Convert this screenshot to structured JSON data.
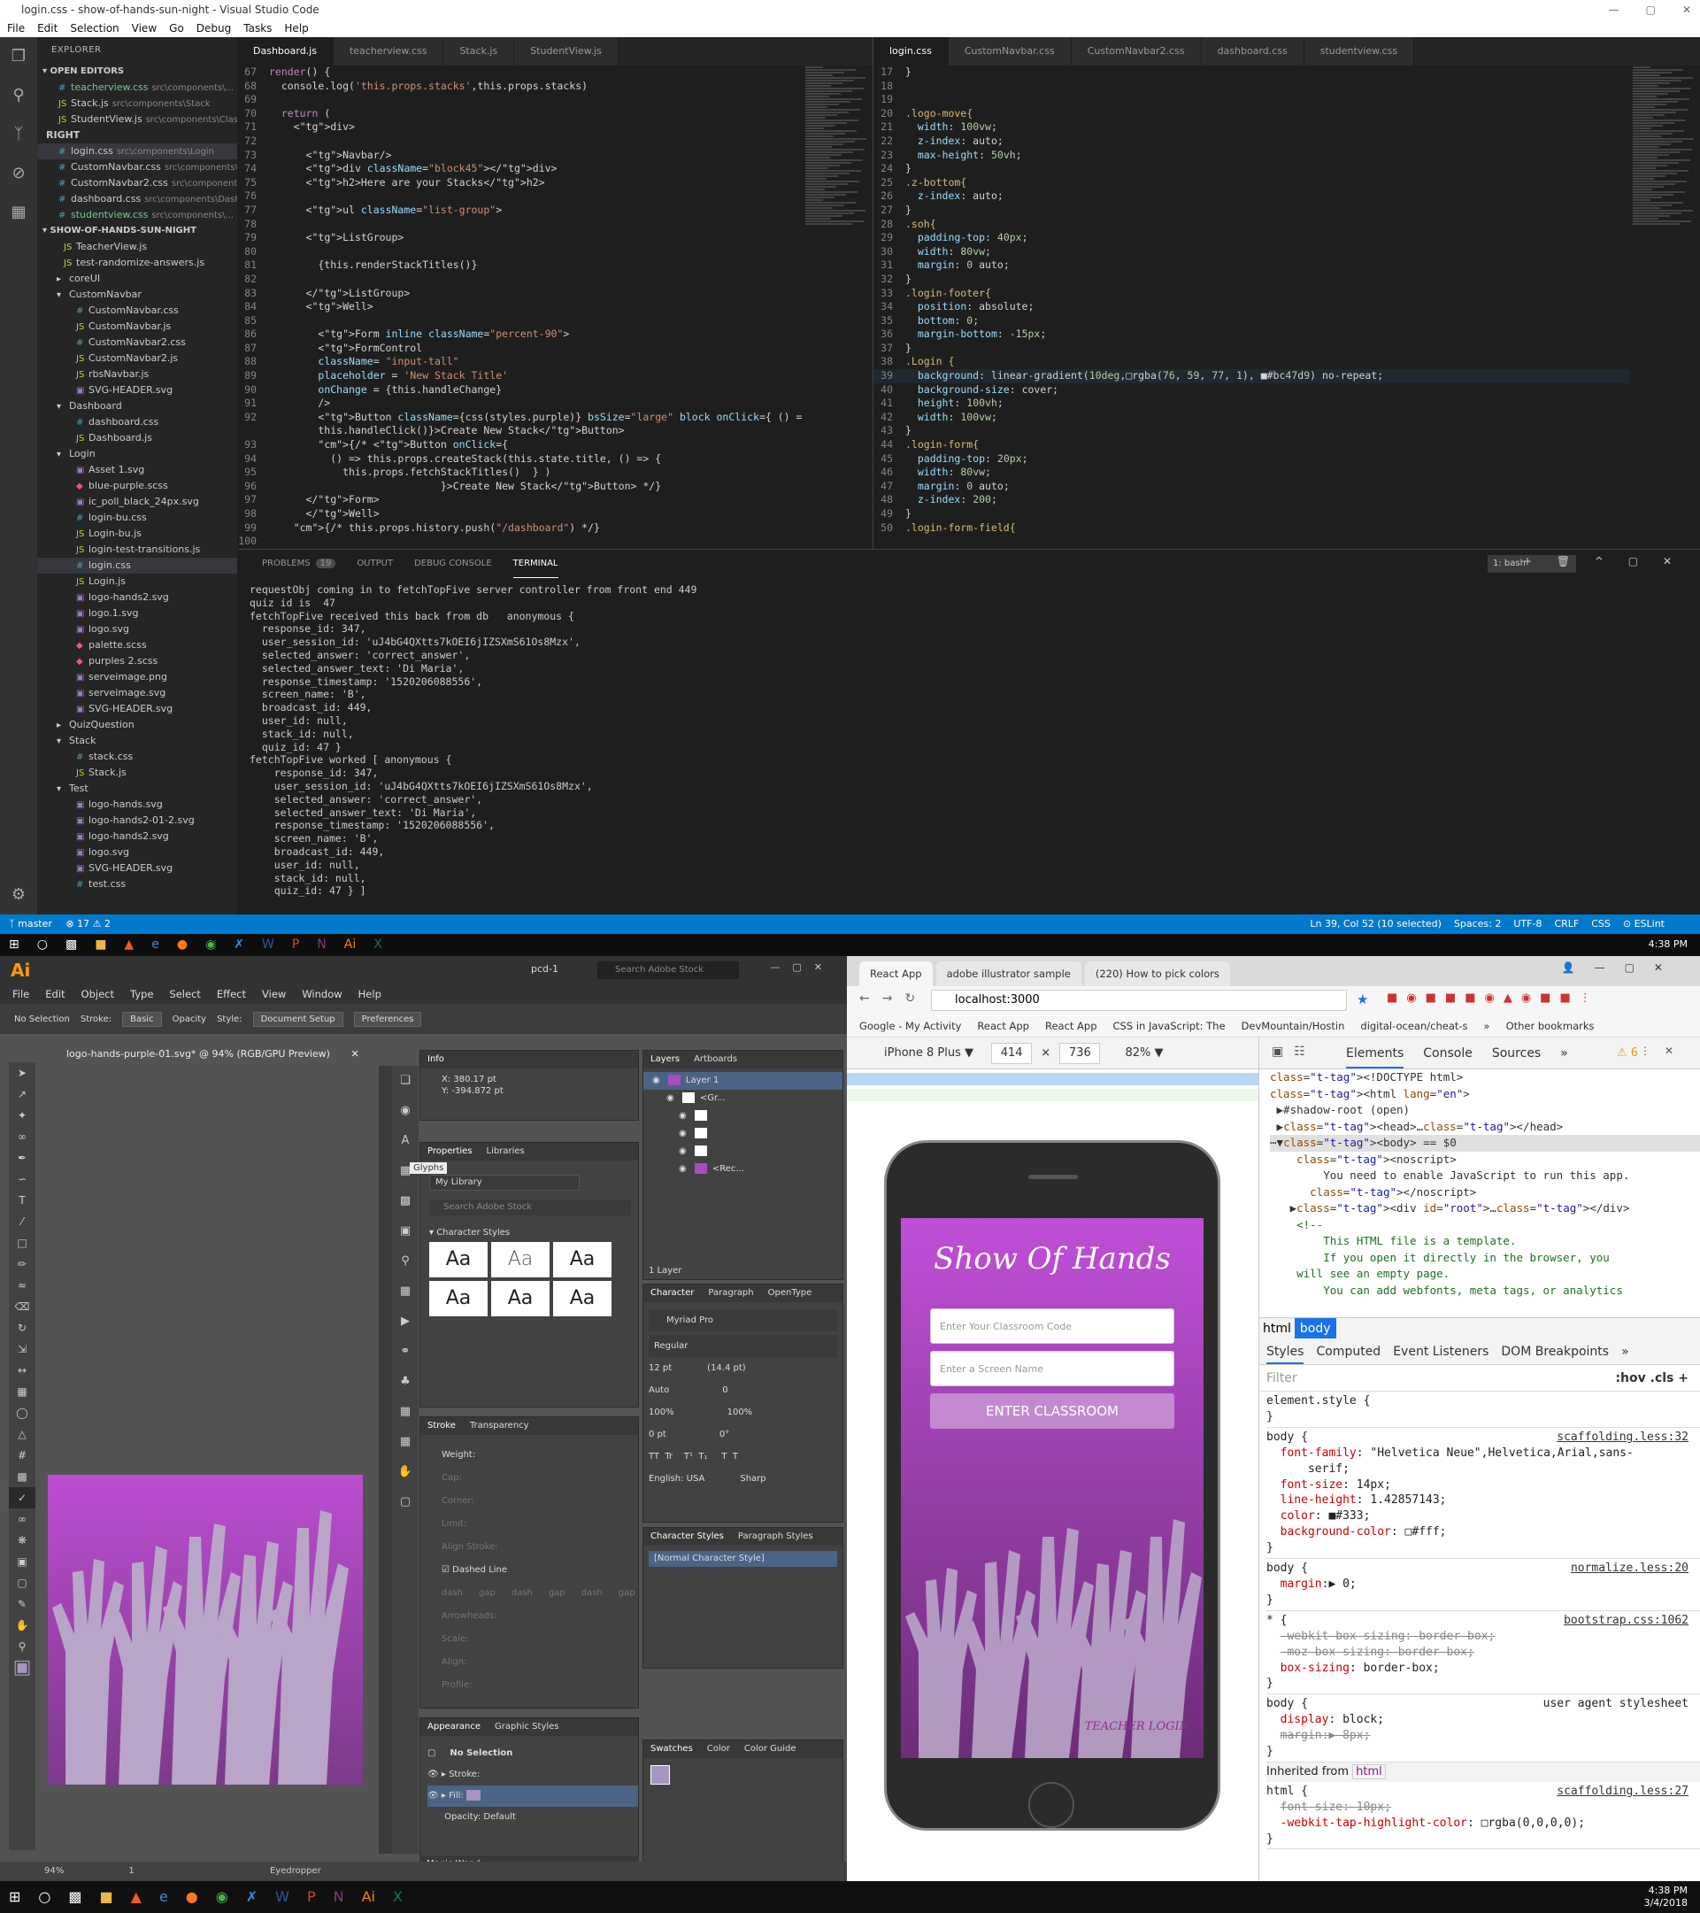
{
  "vscode": {
    "title": "login.css - show-of-hands-sun-night - Visual Studio Code",
    "menu": [
      "File",
      "Edit",
      "Selection",
      "View",
      "Go",
      "Debug",
      "Tasks",
      "Help"
    ],
    "explorer": "EXPLORER",
    "open_editors": "OPEN EDITORS",
    "open_items": [
      {
        "name": "teacherview.css",
        "path": "src\\components\\...",
        "mod": "1"
      },
      {
        "name": "Stack.js",
        "path": "src\\components\\Stack"
      },
      {
        "name": "StudentView.js",
        "path": "src\\components\\Classr..."
      },
      {
        "name": "RIGHT",
        "path": ""
      },
      {
        "name": "login.css",
        "path": "src\\components\\Login"
      },
      {
        "name": "CustomNavbar.css",
        "path": "src\\components\\C..."
      },
      {
        "name": "CustomNavbar2.css",
        "path": "src\\components\\C..."
      },
      {
        "name": "dashboard.css",
        "path": "src\\components\\Dashb..."
      },
      {
        "name": "studentview.css",
        "path": "src\\components\\...",
        "mod": "1"
      }
    ],
    "project": "SHOW-OF-HANDS-SUN-NIGHT",
    "files": [
      "TeacherView.js",
      "test-randomize-answers.js",
      "coreUI",
      "CustomNavbar",
      "CustomNavbar.css",
      "CustomNavbar.js",
      "CustomNavbar2.css",
      "CustomNavbar2.js",
      "rbsNavbar.js",
      "SVG-HEADER.svg",
      "Dashboard",
      "dashboard.css",
      "Dashboard.js",
      "Login",
      "Asset 1.svg",
      "blue-purple.scss",
      "ic_poll_black_24px.svg",
      "login-bu.css",
      "Login-bu.js",
      "login-test-transitions.js",
      "login.css",
      "Login.js",
      "logo-hands2.svg",
      "logo.1.svg",
      "logo.svg",
      "palette.scss",
      "purples 2.scss",
      "serveimage.png",
      "serveimage.svg",
      "SVG-HEADER.svg",
      "QuizQuestion",
      "Stack",
      "stack.css",
      "Stack.js",
      "Test",
      "logo-hands.svg",
      "logo-hands2-01-2.svg",
      "logo-hands2.svg",
      "logo.svg",
      "SVG-HEADER.svg",
      "test.css"
    ],
    "left_tabs": [
      "Dashboard.js",
      "teacherview.css",
      "Stack.js",
      "StudentView.js"
    ],
    "right_tabs": [
      "login.css",
      "CustomNavbar.css",
      "CustomNavbar2.css",
      "dashboard.css",
      "studentview.css"
    ],
    "left_code": [
      [
        "67",
        "render() {"
      ],
      [
        "68",
        "  console.log('this.props.stacks',this.props.stacks)"
      ],
      [
        "69",
        ""
      ],
      [
        "70",
        "  return ("
      ],
      [
        "71",
        "    <div>"
      ],
      [
        "72",
        ""
      ],
      [
        "73",
        "      <Navbar/>"
      ],
      [
        "74",
        "      <div className=\"block45\"></div>"
      ],
      [
        "75",
        "      <h2>Here are your Stacks</h2>"
      ],
      [
        "76",
        ""
      ],
      [
        "77",
        "      <ul className=\"list-group\">"
      ],
      [
        "78",
        ""
      ],
      [
        "79",
        "      <ListGroup>"
      ],
      [
        "80",
        ""
      ],
      [
        "81",
        "        {this.renderStackTitles()}"
      ],
      [
        "82",
        ""
      ],
      [
        "83",
        "      </ListGroup>"
      ],
      [
        "84",
        "      <Well>"
      ],
      [
        "85",
        ""
      ],
      [
        "86",
        "        <Form inline className=\"percent-90\">"
      ],
      [
        "87",
        "        <FormControl"
      ],
      [
        "88",
        "        className= \"input-tall\""
      ],
      [
        "89",
        "        placeholder = 'New Stack Title'"
      ],
      [
        "90",
        "        onChange = {this.handleChange}"
      ],
      [
        "91",
        "        />"
      ],
      [
        "92",
        "        <Button className={css(styles.purple)} bsSize=\"large\" block onClick={ () =>"
      ],
      [
        "",
        "        this.handleClick()}>Create New Stack</Button>"
      ],
      [
        "93",
        "        {/* <Button onClick={"
      ],
      [
        "94",
        "          () => this.props.createStack(this.state.title, () => {"
      ],
      [
        "95",
        "            this.props.fetchStackTitles()  } )"
      ],
      [
        "96",
        "                            }>Create New Stack</Button> */}"
      ],
      [
        "97",
        "      </Form>"
      ],
      [
        "98",
        "      </Well>"
      ],
      [
        "99",
        "    {/* this.props.history.push(\"/dashboard\") */}"
      ],
      [
        "100",
        ""
      ]
    ],
    "right_code": [
      [
        "17",
        "}"
      ],
      [
        "18",
        ""
      ],
      [
        "19",
        ""
      ],
      [
        "20",
        ".logo-move{"
      ],
      [
        "21",
        "  width: 100vw;"
      ],
      [
        "22",
        "  z-index: auto;"
      ],
      [
        "23",
        "  max-height: 50vh;"
      ],
      [
        "24",
        "}"
      ],
      [
        "25",
        ".z-bottom{"
      ],
      [
        "26",
        "  z-index: auto;"
      ],
      [
        "27",
        "}"
      ],
      [
        "28",
        ".soh{"
      ],
      [
        "29",
        "  padding-top: 40px;"
      ],
      [
        "30",
        "  width: 80vw;"
      ],
      [
        "31",
        "  margin: 0 auto;"
      ],
      [
        "32",
        "}"
      ],
      [
        "33",
        ".login-footer{"
      ],
      [
        "34",
        "  position: absolute;"
      ],
      [
        "35",
        "  bottom: 0;"
      ],
      [
        "36",
        "  margin-bottom: -15px;"
      ],
      [
        "37",
        "}"
      ],
      [
        "38",
        ".Login {"
      ],
      [
        "39",
        "  background: linear-gradient(10deg,□rgba(76, 59, 77, 1), ■#bc47d9) no-repeat;"
      ],
      [
        "40",
        "  background-size: cover;"
      ],
      [
        "41",
        "  height: 100vh;"
      ],
      [
        "42",
        "  width: 100vw;"
      ],
      [
        "43",
        "}"
      ],
      [
        "44",
        ".login-form{"
      ],
      [
        "45",
        "  padding-top: 20px;"
      ],
      [
        "46",
        "  width: 80vw;"
      ],
      [
        "47",
        "  margin: 0 auto;"
      ],
      [
        "48",
        "  z-index: 200;"
      ],
      [
        "49",
        "}"
      ],
      [
        "50",
        ".login-form-field{"
      ]
    ],
    "panel_tabs": [
      "PROBLEMS",
      "OUTPUT",
      "DEBUG CONSOLE",
      "TERMINAL"
    ],
    "problems_count": "19",
    "terminal_select": "1: bash",
    "terminal": [
      "requestObj coming in to fetchTopFive server controller from front end 449",
      "quiz id is  47",
      "fetchTopFive received this back from db   anonymous {",
      "  response_id: 347,",
      "  user_session_id: 'uJ4bG4QXtts7kOEI6jIZSXmS61Os8Mzx',",
      "  selected_answer: 'correct_answer',",
      "  selected_answer_text: 'Di Maria',",
      "  response_timestamp: '1520206088556',",
      "  screen_name: 'B',",
      "  broadcast_id: 449,",
      "  user_id: null,",
      "  stack_id: null,",
      "  quiz_id: 47 }",
      "fetchTopFive worked [ anonymous {",
      "    response_id: 347,",
      "    user_session_id: 'uJ4bG4QXtts7kOEI6jIZSXmS61Os8Mzx',",
      "    selected_answer: 'correct_answer',",
      "    selected_answer_text: 'Di Maria',",
      "    response_timestamp: '1520206088556',",
      "    screen_name: 'B',",
      "    broadcast_id: 449,",
      "    user_id: null,",
      "    stack_id: null,",
      "    quiz_id: 47 } ]"
    ],
    "status_left": "master",
    "status_errors": "⊗ 17 ⚠ 2",
    "status_right": [
      "Ln 39, Col 52 (10 selected)",
      "Spaces: 2",
      "UTF-8",
      "CRLF",
      "CSS",
      "⊙ ESLint"
    ]
  },
  "taskbar": {
    "time": "4:38 PM",
    "time2": "4:38 PM",
    "date": "3/4/2018"
  },
  "illustrator": {
    "logo": "Ai",
    "workspace": "pcd-1",
    "search": "Search Adobe Stock",
    "menu": [
      "File",
      "Edit",
      "Object",
      "Type",
      "Select",
      "Effect",
      "View",
      "Window",
      "Help"
    ],
    "ctrl": [
      "No Selection",
      "Stroke:",
      "Basic",
      "Opacity",
      "Style:",
      "Document Setup",
      "Preferences"
    ],
    "doc_tab": "logo-hands-purple-01.svg* @ 94% (RGB/GPU Preview)",
    "info_title": "Info",
    "x": "X: 380.17 pt",
    "y": "Y: -394.872 pt",
    "prop_tabs": [
      "Properties",
      "Libraries"
    ],
    "glyphs": "Glyphs",
    "library": "My Library",
    "lib_search": "Search Adobe Stock",
    "char_styles": "Character Styles",
    "aa": "Aa",
    "stroke_tabs": [
      "Stroke",
      "Transparency"
    ],
    "weight": "Weight:",
    "stroke_labels": [
      "Cap:",
      "Corner:",
      "Limit:",
      "Align Stroke:"
    ],
    "dashed": "Dashed Line",
    "dash_labels": [
      "dash",
      "gap",
      "dash",
      "gap",
      "dash",
      "gap"
    ],
    "arrowheads": "Arrowheads:",
    "scale": "Scale:",
    "align": "Align:",
    "profile": "Profile:",
    "appearance_tabs": [
      "Appearance",
      "Graphic Styles"
    ],
    "no_selection": "No Selection",
    "stroke_lbl": "Stroke:",
    "fill_lbl": "Fill:",
    "opacity_lbl": "Opacity:",
    "opacity_val": "Default",
    "layers_tabs": [
      "Layers",
      "Artboards"
    ],
    "layers": [
      "Layer 1",
      "<Gr...",
      "",
      "",
      "",
      "<Rec..."
    ],
    "layer_count": "1 Layer",
    "character_tabs": [
      "Character",
      "Paragraph",
      "OpenType"
    ],
    "font": "Myriad Pro",
    "font_style": "Regular",
    "size": "12 pt",
    "leading": "(14.4 pt)",
    "kern": "Auto",
    "track": "0",
    "vscale": "100%",
    "hscale": "100%",
    "baseline": "0 pt",
    "rotate": "0°",
    "lang": "English: USA",
    "aa_mode": "Sharp",
    "cs_tabs": [
      "Character Styles",
      "Paragraph Styles"
    ],
    "normal_cs": "[Normal Character Style]",
    "swatch_tabs": [
      "Swatches",
      "Color",
      "Color Guide"
    ],
    "magic": "Magic Wand",
    "zoom": "94%",
    "page": "1",
    "tool": "Eyedropper"
  },
  "chrome": {
    "tabs": [
      "React App",
      "adobe illustrator sample",
      "(220) How to pick colors"
    ],
    "url": "localhost:3000",
    "bookmarks": [
      "Google - My Activity",
      "React App",
      "React App",
      "CSS in JavaScript: The",
      "DevMountain/Hostin",
      "digital-ocean/cheat-s",
      "»",
      "Other bookmarks"
    ],
    "device": "iPhone 8 Plus ▼",
    "width": "414",
    "height": "736",
    "zoom": "82% ▼",
    "app": {
      "title": "Show Of Hands",
      "code_placeholder": "Enter Your Classroom Code",
      "name_placeholder": "Enter a Screen Name",
      "button": "ENTER CLASSROOM",
      "teacher": "TEACHER LOGIN"
    },
    "devtools": {
      "tabs": [
        "Elements",
        "Console",
        "Sources",
        "»"
      ],
      "warnings": "⚠ 6",
      "dom": [
        "<!DOCTYPE html>",
        "<html lang=\"en\">",
        " ▶#shadow-root (open)",
        " ▶<head>…</head>",
        "⋯▼<body> == $0",
        "    <noscript>",
        "        You need to enable JavaScript to run this app.",
        "      </noscript>",
        "   ▶<div id=\"root\">…</div>",
        "    <!--",
        "        This HTML file is a template.",
        "        If you open it directly in the browser, you",
        "    will see an empty page.",
        "",
        "        You can add webfonts, meta tags, or analytics"
      ],
      "crumbs": [
        "html",
        "body"
      ],
      "style_tabs": [
        "Styles",
        "Computed",
        "Event Listeners",
        "DOM Breakpoints",
        "»"
      ],
      "filter": "Filter",
      "filter_opts": ":hov  .cls  +",
      "rules": [
        {
          "sel": "element.style {",
          "src": "",
          "props": []
        },
        {
          "sel": "body {",
          "src": "scaffolding.less:32",
          "props": [
            "font-family: \"Helvetica Neue\",Helvetica,Arial,sans-",
            "    serif;",
            "font-size: 14px;",
            "line-height: 1.42857143;",
            "color: ■#333;",
            "background-color: □#fff;"
          ]
        },
        {
          "sel": "body {",
          "src": "normalize.less:20",
          "props": [
            "margin:▶ 0;"
          ]
        },
        {
          "sel": "* {",
          "src": "bootstrap.css:1062",
          "props": [
            "-webkit-box-sizing: border-box;",
            "-moz-box-sizing: border-box;",
            "box-sizing: border-box;"
          ]
        },
        {
          "sel": "body {",
          "src": "user agent stylesheet",
          "props": [
            "display: block;",
            "margin:▶ 8px;"
          ]
        }
      ],
      "inherited": "Inherited from",
      "inherited_tag": "html",
      "last_sel": "html {",
      "last_src": "scaffolding.less:27",
      "last_props": [
        "font-size: 10px;",
        "-webkit-tap-highlight-color: □rgba(0,0,0,0);"
      ]
    }
  }
}
